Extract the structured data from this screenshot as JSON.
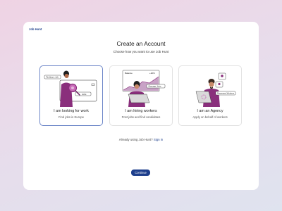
{
  "app": {
    "logo_text": "Job Hunt"
  },
  "header": {
    "title": "Create an Account",
    "subtitle": "Choose how you want to use Job Hunt"
  },
  "options": [
    {
      "label": "I am looking for work",
      "description": "Find jobs in Europe",
      "art": {
        "tag_1": "Finding a Job",
        "tag_2": "Jobs"
      },
      "selected": true
    },
    {
      "label": "I am hiring workers",
      "description": "Post jobs and find candidates",
      "art": {
        "tag_1": "Balance",
        "tag_2": "+20%",
        "tag_3": "Manage Jobs"
      },
      "selected": false
    },
    {
      "label": "I am an Agency",
      "description": "Apply on behalf of workers",
      "art": {
        "tag_1": "Represent Workers"
      },
      "selected": false
    }
  ],
  "signin": {
    "prompt": "Already using Job Hunt?",
    "link_label": "Sign in"
  },
  "footer": {
    "continue_label": "Continue"
  },
  "colors": {
    "brand": "#1d3e8c",
    "accent": "#8a2f7c",
    "selected_border": "#6f88c9",
    "background_top": "#efd3e4",
    "background_bottom": "#dfe3ef"
  }
}
